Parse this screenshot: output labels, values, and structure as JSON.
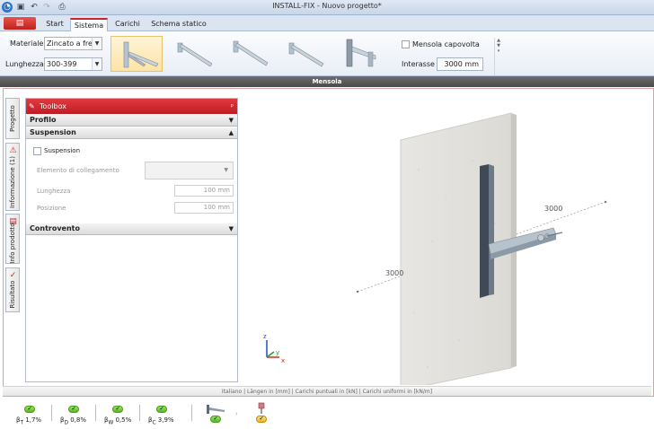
{
  "window": {
    "title": "INSTALL-FIX - Nuovo progetto*"
  },
  "ribbon_tabs": [
    "Start",
    "Sistema",
    "Carichi",
    "Schema statico"
  ],
  "ribbon": {
    "materiale_label": "Materiale",
    "materiale_value": "Zincato a fredd",
    "lunghezza_label": "Lunghezza",
    "lunghezza_value": "300-399",
    "mensola_capovolta_label": "Mensola capovolta",
    "interasse_label": "Interasse",
    "interasse_value": "3000 mm",
    "section_label": "Mensola"
  },
  "side_tabs": [
    "Progetto",
    "Informazione (1)",
    "Info prodotto",
    "Risultato"
  ],
  "toolbox": {
    "title": "Toolbox",
    "groups": {
      "profilo": "Profilo",
      "suspension": "Suspension",
      "controvento": "Controvento"
    },
    "suspension_checkbox": "Suspension",
    "elemento_label": "Elemento di collegamento",
    "lunghezza_label": "Lunghezza",
    "lunghezza_value": "100 mm",
    "posizione_label": "Posizione",
    "posizione_value": "100 mm"
  },
  "viewport": {
    "dim_right": "3000",
    "dim_left": "3000",
    "axis_x": "x",
    "axis_y": "y",
    "axis_z": "z"
  },
  "status_line": "Italiano | Längen in [mm] | Carichi puntuali in [kN] | Carichi uniformi in [kN/m]",
  "results": {
    "items": [
      {
        "sym": "β",
        "sub": "T",
        "value": "1,7%"
      },
      {
        "sym": "β",
        "sub": "D",
        "value": "0,8%"
      },
      {
        "sym": "β",
        "sub": "W",
        "value": "0,5%"
      },
      {
        "sym": "β",
        "sub": "C",
        "value": "3,9%"
      }
    ],
    "check_mark": "✔"
  },
  "colors": {
    "accent_red": "#c8262c",
    "ok_green": "#58b820"
  }
}
